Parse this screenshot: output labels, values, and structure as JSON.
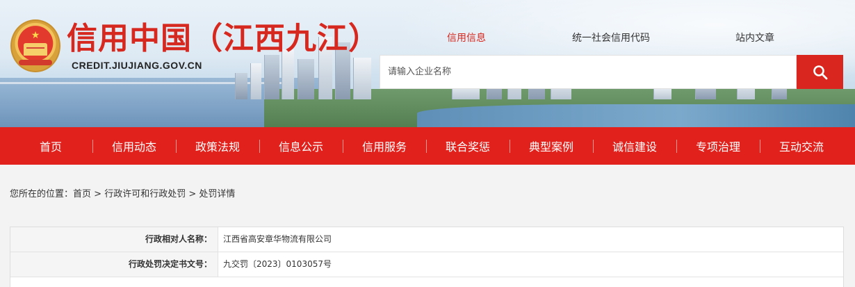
{
  "site": {
    "title": "信用中国（江西九江）",
    "domain": "CREDIT.JIUJIANG.GOV.CN"
  },
  "top_tabs": [
    {
      "label": "信用信息",
      "active": true
    },
    {
      "label": "统一社会信用代码",
      "active": false
    },
    {
      "label": "站内文章",
      "active": false
    }
  ],
  "search": {
    "placeholder": "请输入企业名称",
    "button_icon": "search-icon"
  },
  "nav": [
    {
      "label": "首页"
    },
    {
      "label": "信用动态"
    },
    {
      "label": "政策法规"
    },
    {
      "label": "信息公示"
    },
    {
      "label": "信用服务"
    },
    {
      "label": "联合奖惩"
    },
    {
      "label": "典型案例"
    },
    {
      "label": "诚信建设"
    },
    {
      "label": "专项治理"
    },
    {
      "label": "互动交流"
    }
  ],
  "breadcrumb": {
    "prefix": "您所在的位置：",
    "items": [
      "首页",
      "行政许可和行政处罚",
      "处罚详情"
    ],
    "separator": ">"
  },
  "details": [
    {
      "label": "行政相对人名称：",
      "value": "江西省高安章华物流有限公司"
    },
    {
      "label": "行政处罚决定书文号：",
      "value": "九交罚〔2023〕0103057号"
    }
  ],
  "colors": {
    "brand_red": "#e0211c",
    "title_red": "#d7281f",
    "active_tab": "#d7281f"
  }
}
